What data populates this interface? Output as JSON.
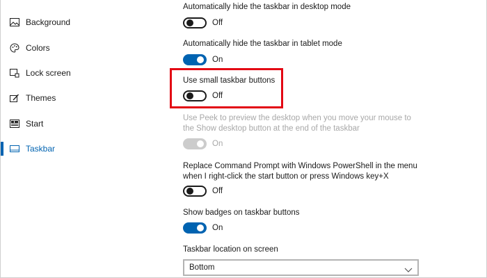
{
  "sidebar": {
    "items": [
      {
        "label": "Background",
        "icon": "background-image-icon"
      },
      {
        "label": "Colors",
        "icon": "palette-icon"
      },
      {
        "label": "Lock screen",
        "icon": "lock-screen-icon"
      },
      {
        "label": "Themes",
        "icon": "themes-icon"
      },
      {
        "label": "Start",
        "icon": "start-icon"
      },
      {
        "label": "Taskbar",
        "icon": "taskbar-icon"
      }
    ],
    "active": "Taskbar"
  },
  "settings": {
    "autohide_desktop": {
      "label": "Automatically hide the taskbar in desktop mode",
      "state": "Off"
    },
    "autohide_tablet": {
      "label": "Automatically hide the taskbar in tablet mode",
      "state": "On"
    },
    "small_buttons": {
      "label": "Use small taskbar buttons",
      "state": "Off"
    },
    "peek": {
      "label_line1": "Use Peek to preview the desktop when you move your mouse to",
      "label_line2": "the Show desktop button at the end of the taskbar",
      "state": "On"
    },
    "powershell": {
      "label_line1": "Replace Command Prompt with Windows PowerShell in the menu",
      "label_line2": "when I right-click the start button or press Windows key+X",
      "state": "Off"
    },
    "badges": {
      "label": "Show badges on taskbar buttons",
      "state": "On"
    },
    "location": {
      "label": "Taskbar location on screen",
      "value": "Bottom"
    }
  },
  "colors": {
    "accent": "#0063b1",
    "highlight_border": "#e30613",
    "disabled": "#a8a8a8"
  }
}
